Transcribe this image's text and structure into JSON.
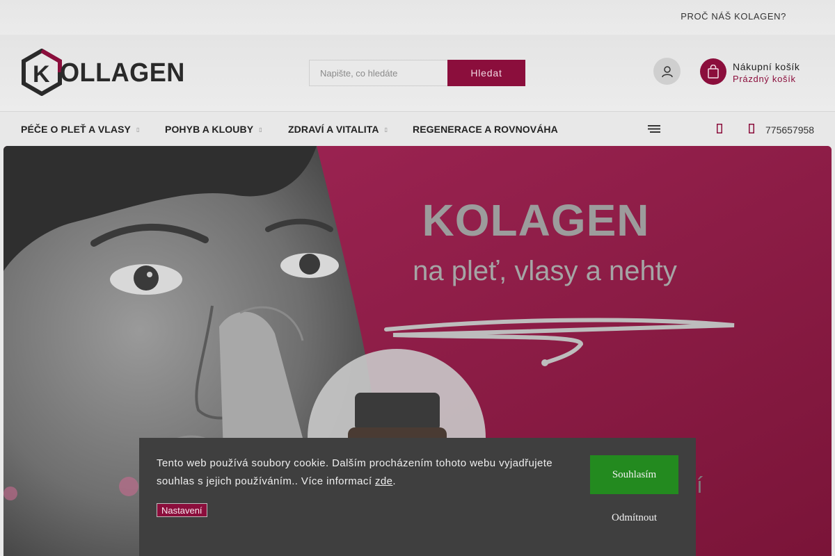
{
  "topbar": {
    "link": "PROČ NÁŠ KOLAGEN?"
  },
  "header": {
    "logo_text": "OLLAGEN",
    "logo_letter": "K",
    "search": {
      "placeholder": "Napište, co hledáte",
      "button": "Hledat"
    },
    "cart": {
      "title": "Nákupní košík",
      "status": "Prázdný košík"
    }
  },
  "nav": {
    "items": [
      {
        "label": "PÉČE O PLEŤ A VLASY"
      },
      {
        "label": "POHYB A KLOUBY"
      },
      {
        "label": "ZDRAVÍ A VITALITA"
      },
      {
        "label": "REGENERACE A ROVNOVÁHA"
      }
    ],
    "phone": "775657958"
  },
  "hero": {
    "title": "KOLAGEN",
    "subtitle": "na pleť, vlasy a nehty",
    "partial_text": "ší"
  },
  "cookie": {
    "text": "Tento web používá soubory cookie. Dalším procházením tohoto webu vyjadřujete souhlas s jejich používáním.. Více informací ",
    "link": "zde",
    "after_link": ".",
    "settings": "Nastavení",
    "accept": "Souhlasím",
    "decline": "Odmítnout"
  },
  "colors": {
    "brand": "#8b0e3c",
    "hero_bg": "#951e4b",
    "accept": "#238a1f",
    "cookie_bg": "#3f3f3f"
  }
}
